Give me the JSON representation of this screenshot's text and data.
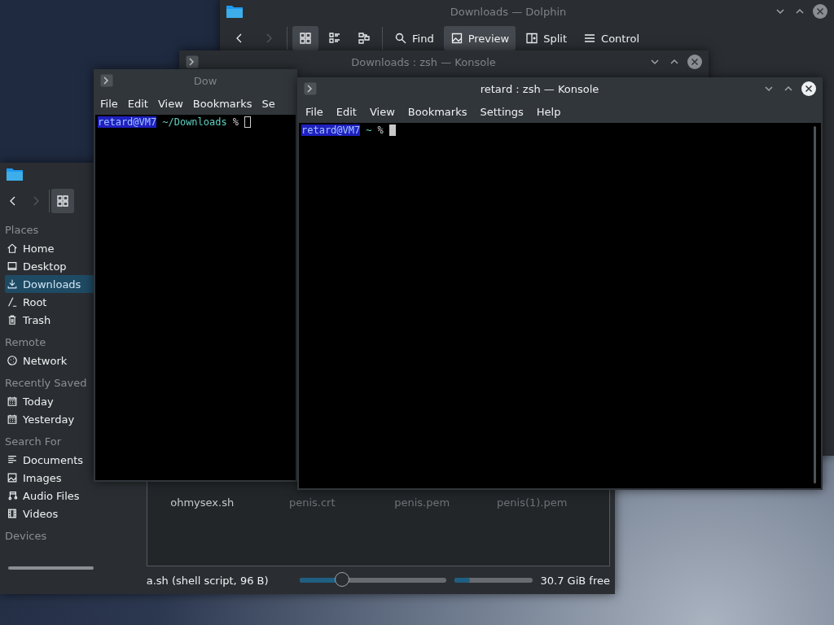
{
  "dolphin_main": {
    "title": "Downloads — Dolphin",
    "toolbar": [
      {
        "kind": "back",
        "selected": false,
        "disabled": false
      },
      {
        "kind": "forward",
        "selected": false,
        "disabled": true
      },
      {
        "kind": "icons",
        "selected": true,
        "disabled": false
      },
      {
        "kind": "details",
        "selected": false,
        "disabled": false
      },
      {
        "kind": "compact",
        "selected": false,
        "disabled": false
      },
      {
        "kind": "find",
        "label": "Find",
        "selected": false,
        "disabled": false
      },
      {
        "kind": "preview",
        "label": "Preview",
        "selected": true,
        "disabled": false
      },
      {
        "kind": "split",
        "label": "Split",
        "selected": false,
        "disabled": false
      },
      {
        "kind": "control",
        "label": "Control",
        "selected": false,
        "disabled": false
      }
    ]
  },
  "konsole_back": {
    "title": "Downloads : zsh — Konsole"
  },
  "dolphin_left": {
    "toolbar": [
      {
        "kind": "back",
        "selected": false,
        "disabled": false
      },
      {
        "kind": "forward",
        "selected": false,
        "disabled": true
      },
      {
        "kind": "icons",
        "selected": true,
        "disabled": false
      }
    ],
    "sidebar": [
      {
        "heading": "Places",
        "items": [
          {
            "kind": "home",
            "label": "Home",
            "selected": false
          },
          {
            "kind": "desktop",
            "label": "Desktop",
            "selected": false
          },
          {
            "kind": "downloads",
            "label": "Downloads",
            "selected": true
          },
          {
            "kind": "root",
            "label": "Root",
            "selected": false
          },
          {
            "kind": "trash",
            "label": "Trash",
            "selected": false
          }
        ]
      },
      {
        "heading": "Remote",
        "items": [
          {
            "kind": "network",
            "label": "Network",
            "selected": false
          }
        ]
      },
      {
        "heading": "Recently Saved",
        "items": [
          {
            "kind": "calendar",
            "label": "Today",
            "selected": false
          },
          {
            "kind": "calendar",
            "label": "Yesterday",
            "selected": false
          }
        ]
      },
      {
        "heading": "Search For",
        "items": [
          {
            "kind": "documents",
            "label": "Documents",
            "selected": false
          },
          {
            "kind": "images",
            "label": "Images",
            "selected": false
          },
          {
            "kind": "audio",
            "label": "Audio Files",
            "selected": false
          },
          {
            "kind": "videos",
            "label": "Videos",
            "selected": false
          }
        ]
      },
      {
        "heading": "Devices"
      }
    ],
    "files": [
      {
        "name": "ohmysex.sh",
        "hidden": false
      },
      {
        "name": "penis.crt",
        "hidden": true
      },
      {
        "name": "penis.pem",
        "hidden": true
      },
      {
        "name": "penis(1).pem",
        "hidden": true
      }
    ],
    "status": {
      "text": "a.sh (shell script, 96 B)",
      "zoom": {
        "level": 0.27
      },
      "space": {
        "level": 0.2,
        "reading": "30.7 GiB free"
      }
    }
  },
  "konsole_left": {
    "title": "Dow",
    "focused": false,
    "menu": [
      "File",
      "Edit",
      "View",
      "Bookmarks",
      "Se"
    ],
    "prompt": {
      "user": "retard@VM7",
      "path": "~/Downloads",
      "symbol": "%"
    }
  },
  "konsole_front": {
    "title": "retard : zsh — Konsole",
    "focused": true,
    "menu": [
      "File",
      "Edit",
      "View",
      "Bookmarks",
      "Settings",
      "Help"
    ],
    "prompt": {
      "user": "retard@VM7",
      "path": "~",
      "symbol": "%"
    }
  }
}
